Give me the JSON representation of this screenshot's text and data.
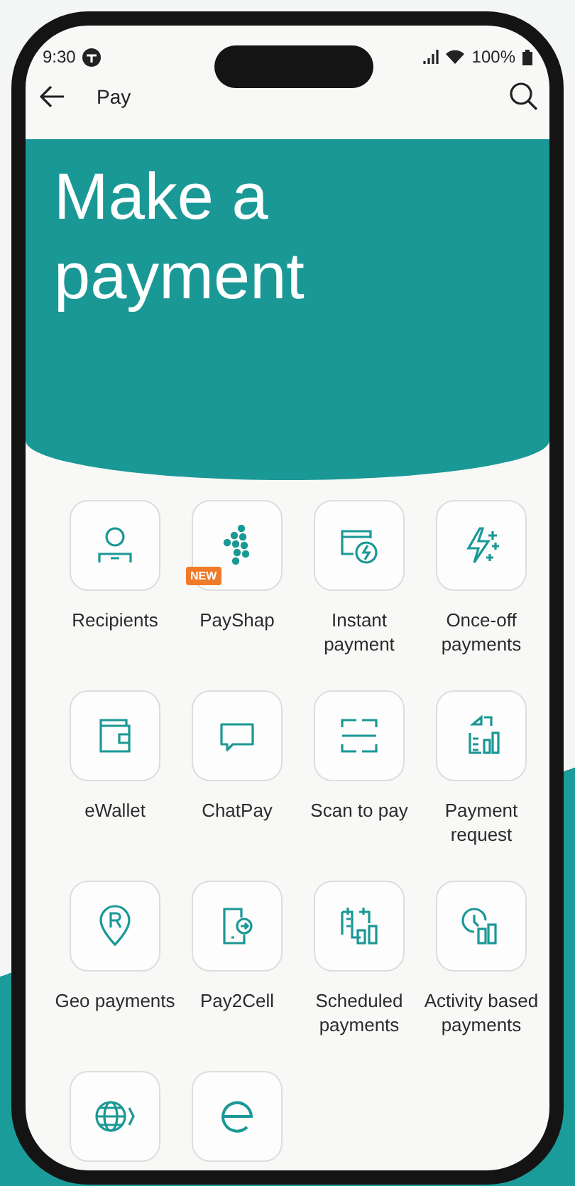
{
  "status_bar": {
    "time": "9:30",
    "battery": "100%"
  },
  "app_bar": {
    "title": "Pay"
  },
  "hero": {
    "title": "Make a payment"
  },
  "items": [
    {
      "kind": "tile",
      "label": "Recipients"
    },
    {
      "kind": "tile",
      "label": "PayShap",
      "badge": "NEW"
    },
    {
      "kind": "tile",
      "label": "Instant payment"
    },
    {
      "kind": "tile",
      "label": "Once-off payments"
    },
    {
      "kind": "tile",
      "label": "eWallet"
    },
    {
      "kind": "tile",
      "label": "ChatPay"
    },
    {
      "kind": "tile",
      "label": "Scan to pay"
    },
    {
      "kind": "tile",
      "label": "Payment request"
    },
    {
      "kind": "tile",
      "label": "Geo payments"
    },
    {
      "kind": "tile",
      "label": "Pay2Cell"
    },
    {
      "kind": "tile",
      "label": "Scheduled payments"
    },
    {
      "kind": "tile",
      "label": "Activity based payments"
    },
    {
      "kind": "tile"
    },
    {
      "kind": "tile"
    }
  ]
}
